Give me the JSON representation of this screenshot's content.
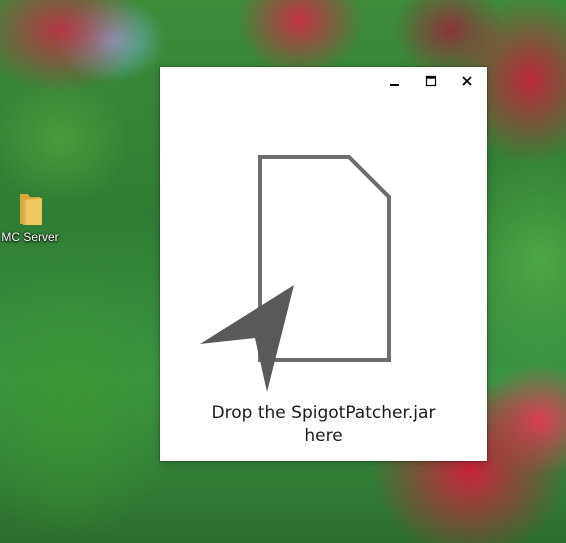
{
  "desktop": {
    "icons": [
      {
        "label": "MC Server",
        "icon": "folder-icon"
      }
    ]
  },
  "window": {
    "controls": {
      "minimize_icon": "minimize-icon",
      "maximize_icon": "maximize-icon",
      "close_icon": "close-icon"
    },
    "drop_zone": {
      "document_icon": "document-icon",
      "pointer_icon": "cursor-arrow-icon",
      "line1": "Drop the SpigotPatcher.jar",
      "line2": "here"
    }
  },
  "colors": {
    "window_background": "#ffffff",
    "graphic_stroke": "#6e6e6e",
    "text": "#1a1a1a",
    "folder": "#e8b84a"
  }
}
